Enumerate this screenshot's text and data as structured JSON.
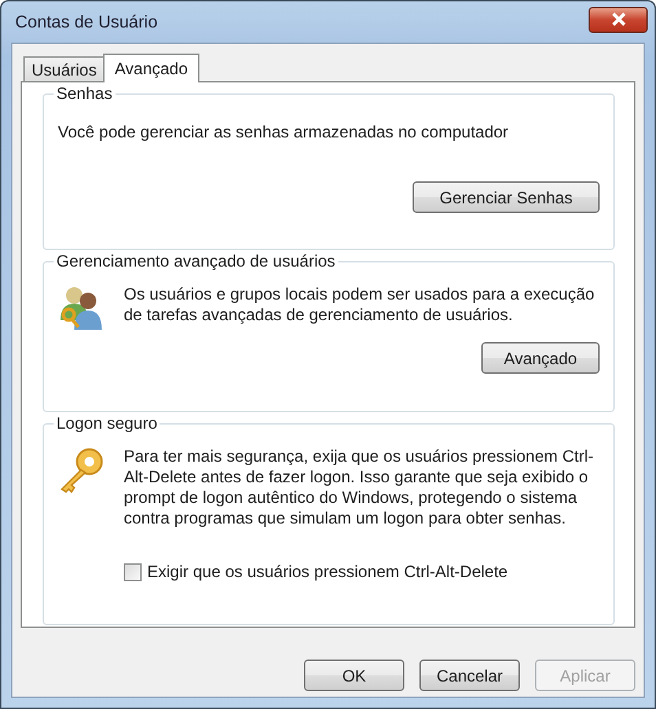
{
  "window": {
    "title": "Contas de Usuário"
  },
  "tabs": [
    {
      "label": "Usuários",
      "selected": false
    },
    {
      "label": "Avançado",
      "selected": true
    }
  ],
  "groups": [
    {
      "kind": "plain",
      "title": "Senhas",
      "text": "Você pode gerenciar as senhas armazenadas no computador",
      "button": "Gerenciar Senhas"
    },
    {
      "kind": "users",
      "title": "Gerenciamento avançado de usuários",
      "text": "Os usuários e grupos locais podem ser usados para a execução de tarefas avançadas de gerenciamento de usuários.",
      "button": "Avançado"
    },
    {
      "kind": "key",
      "title": "Logon seguro",
      "text": "Para ter mais segurança, exija que os usuários pressionem Ctrl-Alt-Delete antes de fazer logon. Isso garante que seja exibido o prompt de logon autêntico do Windows, protegendo o sistema contra programas que simulam um logon para obter senhas.",
      "checkbox": {
        "label": "Exigir que os usuários pressionem Ctrl-Alt-Delete",
        "checked": false
      }
    }
  ],
  "buttons": [
    {
      "label": "OK",
      "disabled": false
    },
    {
      "label": "Cancelar",
      "disabled": false
    },
    {
      "label": "Aplicar",
      "disabled": true
    }
  ]
}
